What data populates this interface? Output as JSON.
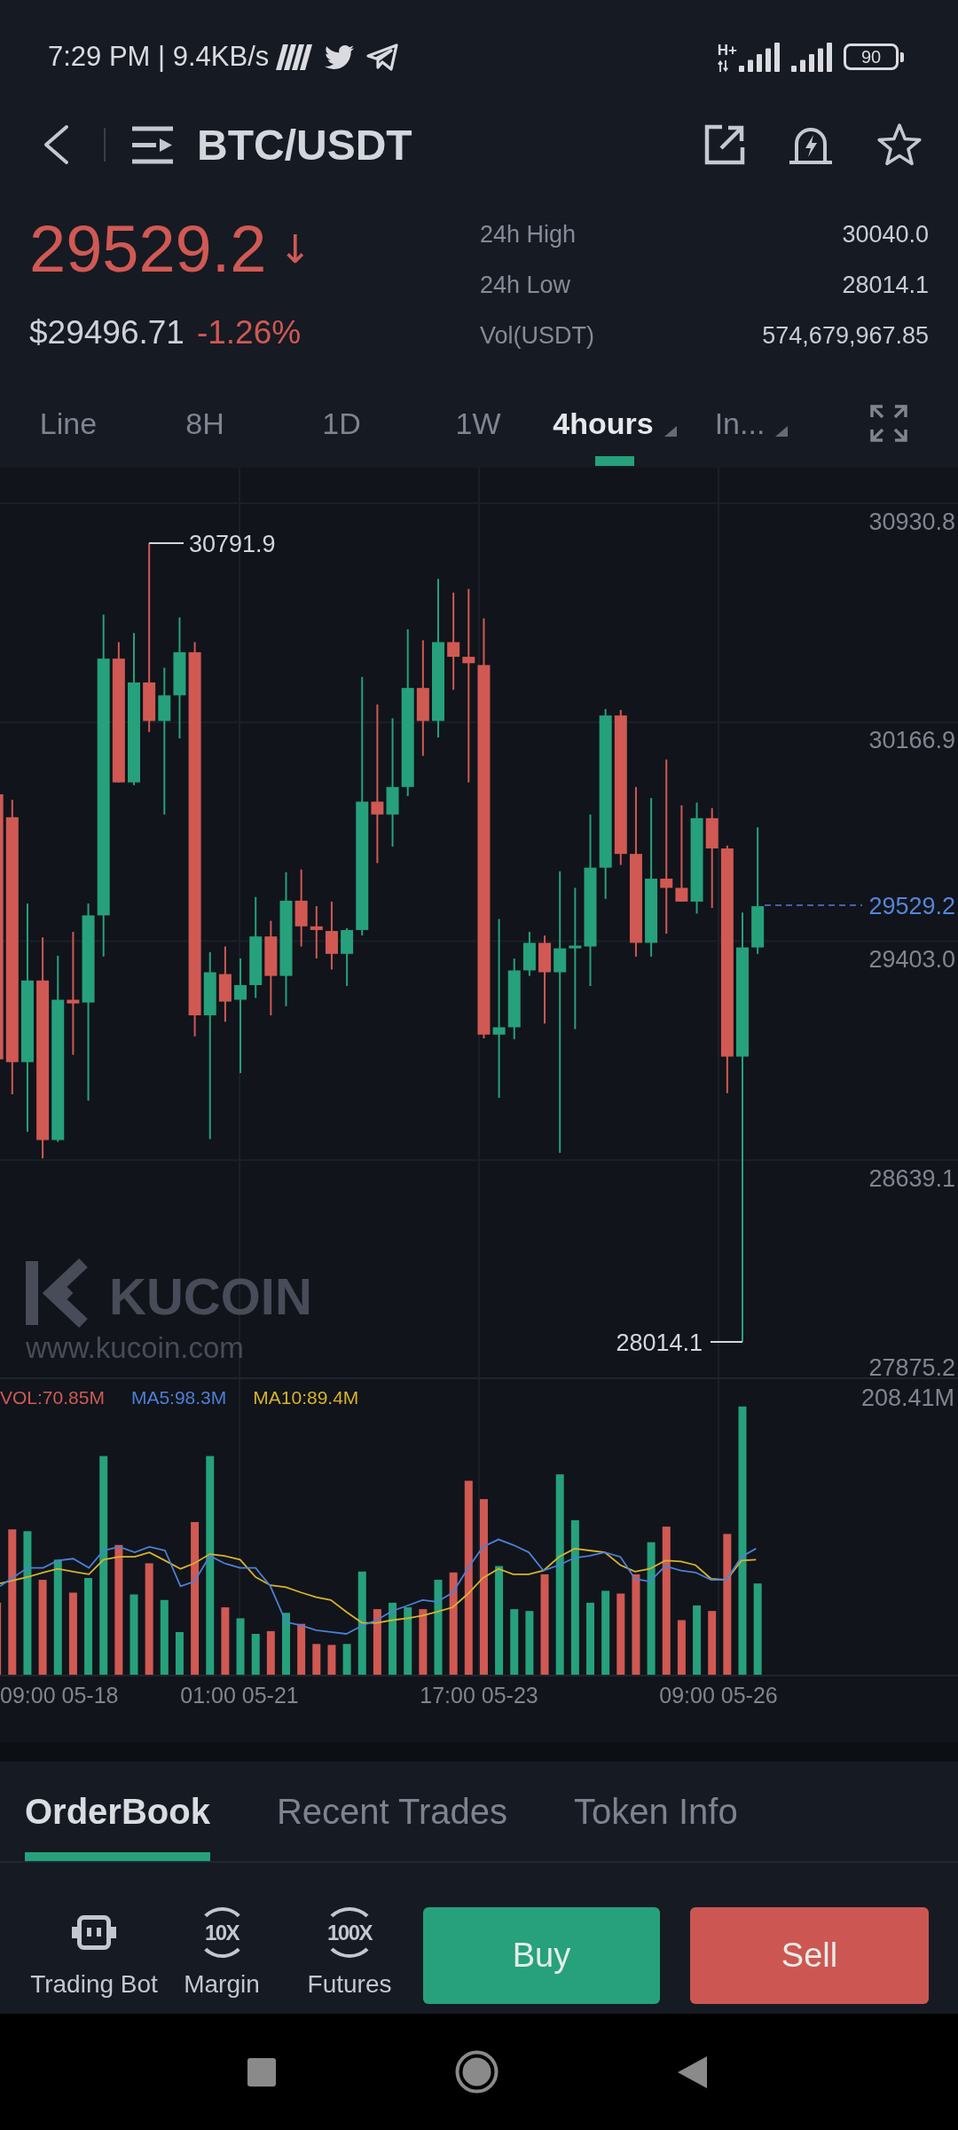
{
  "status_bar": {
    "info": "7:29 PM | 9.4KB/s",
    "network_type": "H+",
    "battery": "90"
  },
  "header": {
    "pair": "BTC/USDT"
  },
  "ticker": {
    "last_price": "29529.2",
    "falling": true,
    "arrow": "↓",
    "fiat_price": "$29496.71",
    "change": "-1.26%",
    "stats": [
      {
        "label": "24h High",
        "value": "30040.0"
      },
      {
        "label": "24h Low",
        "value": "28014.1"
      },
      {
        "label": "Vol(USDT)",
        "value": "574,679,967.85"
      }
    ]
  },
  "intervals": [
    {
      "label": "Line",
      "selected": false,
      "dropdown": false
    },
    {
      "label": "8H",
      "selected": false,
      "dropdown": false
    },
    {
      "label": "1D",
      "selected": false,
      "dropdown": false
    },
    {
      "label": "1W",
      "selected": false,
      "dropdown": false
    },
    {
      "label": "4hours",
      "selected": true,
      "dropdown": true
    },
    {
      "label": "In...",
      "selected": false,
      "dropdown": true
    }
  ],
  "chart": {
    "price_axis": [
      "30930.8",
      "30166.9",
      "29403.0",
      "28639.1",
      "27875.2"
    ],
    "last_price": "29529.2",
    "high_label": "30791.9",
    "low_label": "28014.1",
    "watermark": {
      "brand": "KUCOIN",
      "site": "www.kucoin.com"
    },
    "volume_legend": [
      {
        "label": "VOL:70.85M",
        "color": "#d05a55"
      },
      {
        "label": "MA5:98.3M",
        "color": "#4d7fd6"
      },
      {
        "label": "MA10:89.4M",
        "color": "#d6b32e"
      }
    ],
    "volume_axis": "208.41M",
    "time_axis": [
      "09:00 05-18",
      "01:00 05-21",
      "17:00 05-23",
      "09:00 05-26"
    ]
  },
  "section_tabs": [
    {
      "label": "OrderBook",
      "selected": true
    },
    {
      "label": "Recent Trades",
      "selected": false
    },
    {
      "label": "Token Info",
      "selected": false
    }
  ],
  "actions": {
    "shortcuts": [
      {
        "label": "Trading Bot",
        "kind": "bot"
      },
      {
        "label": "Margin",
        "kind": "leverage",
        "badge": "10X"
      },
      {
        "label": "Futures",
        "kind": "leverage",
        "badge": "100X"
      }
    ],
    "buy": "Buy",
    "sell": "Sell"
  }
}
